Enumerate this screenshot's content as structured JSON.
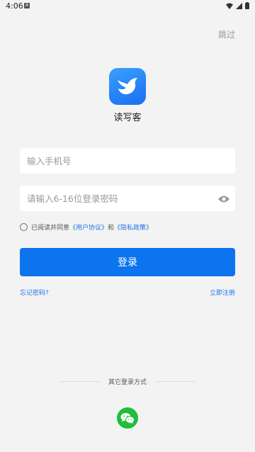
{
  "status_bar": {
    "time": "4:06"
  },
  "header": {
    "skip_label": "跳过"
  },
  "app": {
    "name": "读写客"
  },
  "form": {
    "phone_placeholder": "输入手机号",
    "password_placeholder": "请输入6-16位登录密码"
  },
  "agreement": {
    "prefix": "已阅读并同意",
    "user_agreement": "《用户协议》",
    "and": "和",
    "privacy_policy": "《隐私政策》"
  },
  "actions": {
    "login_label": "登录",
    "forgot_label": "忘记密码?",
    "register_label": "立即注册"
  },
  "other_login": {
    "label": "其它登录方式",
    "providers": [
      "wechat-icon"
    ]
  },
  "colors": {
    "primary": "#0d74f0",
    "link": "#1e73e8",
    "wechat": "#1fbf3c",
    "background": "#f3f3f3"
  }
}
